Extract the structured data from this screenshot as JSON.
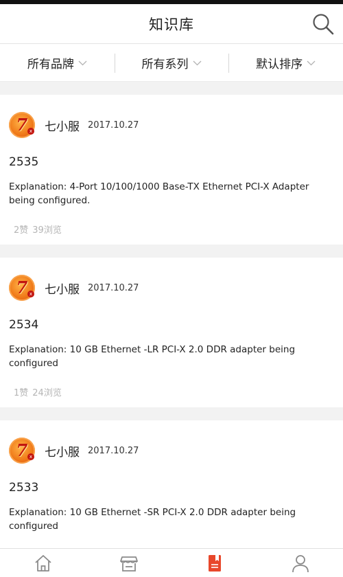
{
  "header": {
    "title": "知识库"
  },
  "filters": [
    {
      "label": "所有品牌"
    },
    {
      "label": "所有系列"
    },
    {
      "label": "默认排序"
    }
  ],
  "posts": [
    {
      "author": "七小服",
      "date": "2017.10.27",
      "number": "2535",
      "explanation": "Explanation: 4-Port 10/100/1000 Base-TX Ethernet PCI-X Adapter being configured.",
      "likes": "2赞",
      "views": "39浏览"
    },
    {
      "author": "七小服",
      "date": "2017.10.27",
      "number": "2534",
      "explanation": "Explanation: 10 GB Ethernet -LR PCI-X 2.0 DDR adapter being configured",
      "likes": "1赞",
      "views": "24浏览"
    },
    {
      "author": "七小服",
      "date": "2017.10.27",
      "number": "2533",
      "explanation": "Explanation: 10 GB Ethernet -SR PCI-X 2.0 DDR adapter being configured",
      "likes": "",
      "views": ""
    }
  ],
  "avatar": {
    "glyph": "7",
    "badge": "x"
  },
  "tabbar": [
    {
      "icon": "home-icon",
      "active": false
    },
    {
      "icon": "store-icon",
      "active": false
    },
    {
      "icon": "knowledge-book-icon",
      "active": true
    },
    {
      "icon": "user-icon",
      "active": false
    }
  ],
  "colors": {
    "accent": "#e8472b",
    "inactive": "#8a8a8a",
    "muted": "#b5b5b5"
  }
}
